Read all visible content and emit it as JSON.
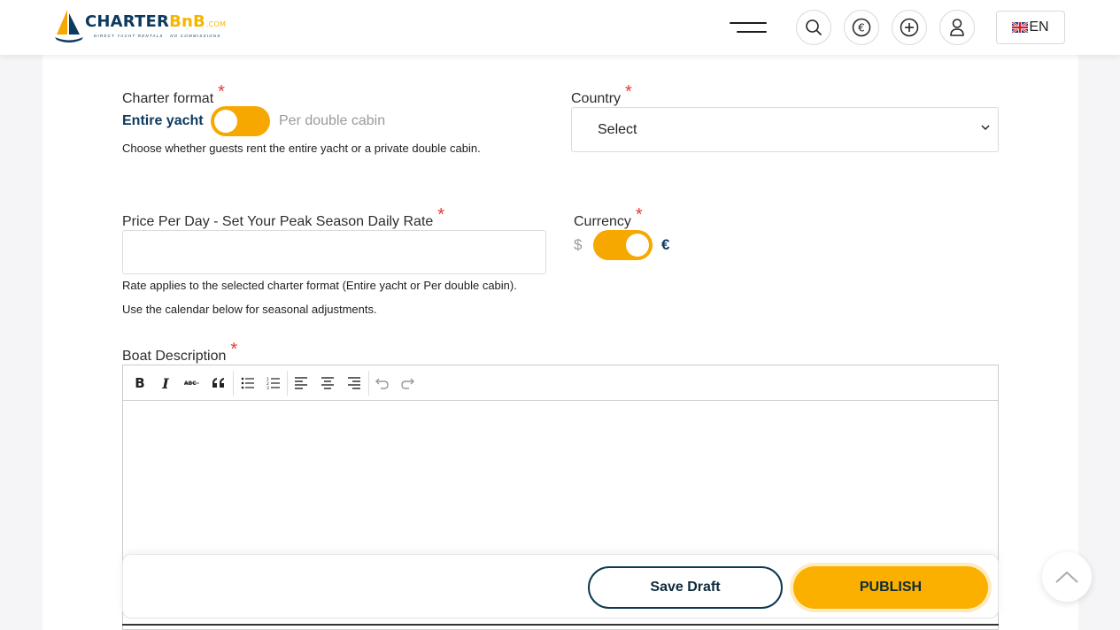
{
  "brand": {
    "name_part1": "CHARTER",
    "name_part2": "BnB",
    "name_suffix": ".COM",
    "tagline": "DIRECT YACHT RENTALS · NO COMMISSIONS"
  },
  "header": {
    "icons": [
      "menu-icon",
      "search-icon",
      "euro-icon",
      "add-icon",
      "user-icon"
    ],
    "language": "EN"
  },
  "form": {
    "charter_format": {
      "label": "Charter format",
      "required_mark": "*",
      "option_left": "Entire yacht",
      "option_right": "Per double cabin",
      "selected": "Entire yacht",
      "help": "Choose whether guests rent the entire yacht or a private double cabin."
    },
    "country": {
      "label": "Country",
      "required_mark": "*",
      "value": "Select"
    },
    "price": {
      "label": "Price Per Day - Set Your Peak Season Daily Rate",
      "required_mark": "*",
      "value": "",
      "help1": "Rate applies to the selected charter format (Entire yacht or Per double cabin).",
      "help2": "Use the calendar below for seasonal adjustments."
    },
    "currency": {
      "label": "Currency",
      "required_mark": "*",
      "option_left": "$",
      "option_right": "€",
      "selected": "€"
    },
    "description": {
      "label": "Boat Description",
      "required_mark": "*",
      "toolbar": [
        "bold",
        "italic",
        "strikethrough",
        "blockquote",
        "bulleted-list",
        "numbered-list",
        "align-left",
        "align-center",
        "align-right",
        "undo",
        "redo"
      ],
      "value": ""
    }
  },
  "actions": {
    "save_draft": "Save Draft",
    "publish": "PUBLISH"
  },
  "colors": {
    "accent": "#f7a800",
    "navy": "#0d3a5f",
    "required": "#e53935"
  }
}
